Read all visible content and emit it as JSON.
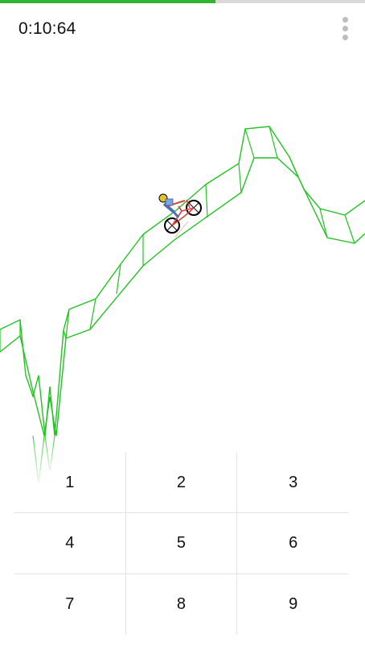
{
  "game": {
    "timer": "0:10:64",
    "progress": 0.59,
    "colors": {
      "track": "#22c322",
      "progress_fill": "#2fb52f",
      "progress_track": "#d9d9d9"
    }
  },
  "menu": {
    "icon": "more-vert-icon"
  },
  "keypad": {
    "keys": [
      "1",
      "2",
      "3",
      "4",
      "5",
      "6",
      "7",
      "8",
      "9"
    ]
  }
}
